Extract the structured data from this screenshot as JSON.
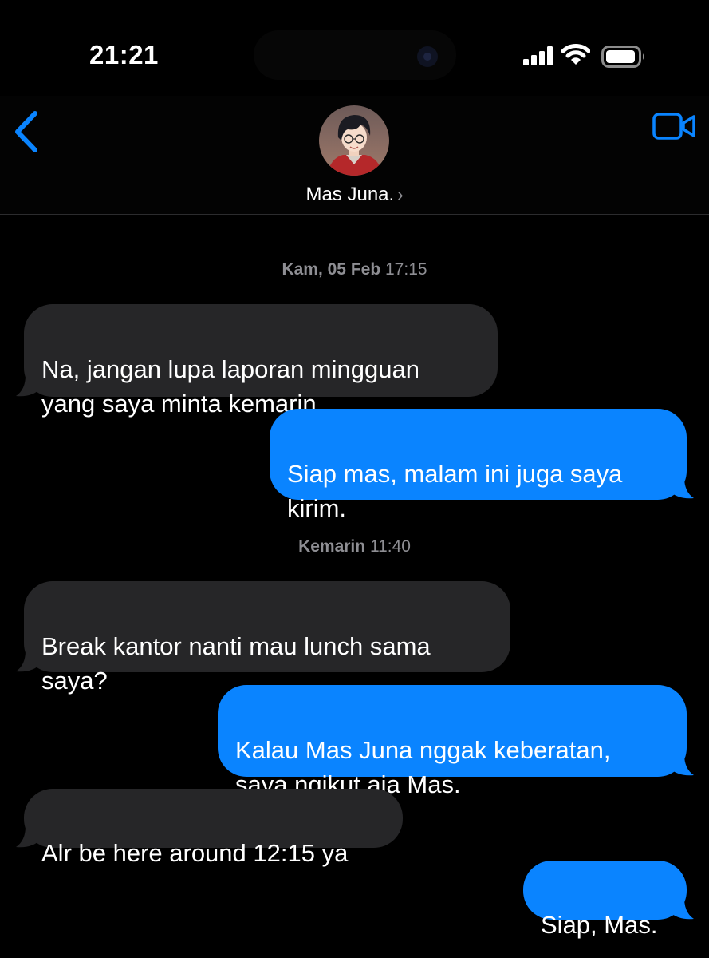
{
  "status_bar": {
    "time": "21:21",
    "signal_icon": "cellular-signal-icon",
    "wifi_icon": "wifi-icon",
    "battery_icon": "battery-icon"
  },
  "header": {
    "back_icon": "chevron-left-icon",
    "contact_name": "Mas Juna.",
    "chevron": "›",
    "video_icon": "video-camera-icon"
  },
  "colors": {
    "accent": "#0a84ff",
    "incoming_bubble": "#262628",
    "background": "#000000",
    "timestamp_text": "#8e8e93"
  },
  "conversation": {
    "groups": [
      {
        "timestamp_day": "Kam, 05 Feb",
        "timestamp_time": "17:15"
      },
      {
        "timestamp_day": "Kemarin",
        "timestamp_time": "11:40"
      }
    ],
    "messages": [
      {
        "direction": "incoming",
        "text": "Na, jangan lupa laporan mingguan\nyang saya minta kemarin"
      },
      {
        "direction": "outgoing",
        "text": "Siap mas, malam ini juga saya\nkirim."
      },
      {
        "direction": "incoming",
        "text": "Break kantor nanti mau lunch sama\nsaya?"
      },
      {
        "direction": "outgoing",
        "text": "Kalau Mas Juna nggak keberatan,\nsaya ngikut aja Mas."
      },
      {
        "direction": "incoming",
        "text": "Alr be here around 12:15 ya"
      },
      {
        "direction": "outgoing",
        "text": "Siap, Mas."
      }
    ]
  }
}
